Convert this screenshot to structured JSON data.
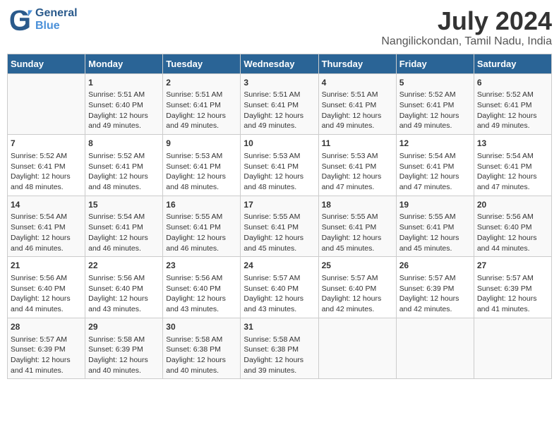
{
  "header": {
    "logo_line1": "General",
    "logo_line2": "Blue",
    "title": "July 2024",
    "subtitle": "Nangilickondan, Tamil Nadu, India"
  },
  "days_of_week": [
    "Sunday",
    "Monday",
    "Tuesday",
    "Wednesday",
    "Thursday",
    "Friday",
    "Saturday"
  ],
  "weeks": [
    [
      {
        "day": "",
        "content": ""
      },
      {
        "day": "1",
        "content": "Sunrise: 5:51 AM\nSunset: 6:40 PM\nDaylight: 12 hours\nand 49 minutes."
      },
      {
        "day": "2",
        "content": "Sunrise: 5:51 AM\nSunset: 6:41 PM\nDaylight: 12 hours\nand 49 minutes."
      },
      {
        "day": "3",
        "content": "Sunrise: 5:51 AM\nSunset: 6:41 PM\nDaylight: 12 hours\nand 49 minutes."
      },
      {
        "day": "4",
        "content": "Sunrise: 5:51 AM\nSunset: 6:41 PM\nDaylight: 12 hours\nand 49 minutes."
      },
      {
        "day": "5",
        "content": "Sunrise: 5:52 AM\nSunset: 6:41 PM\nDaylight: 12 hours\nand 49 minutes."
      },
      {
        "day": "6",
        "content": "Sunrise: 5:52 AM\nSunset: 6:41 PM\nDaylight: 12 hours\nand 49 minutes."
      }
    ],
    [
      {
        "day": "7",
        "content": "Sunrise: 5:52 AM\nSunset: 6:41 PM\nDaylight: 12 hours\nand 48 minutes."
      },
      {
        "day": "8",
        "content": "Sunrise: 5:52 AM\nSunset: 6:41 PM\nDaylight: 12 hours\nand 48 minutes."
      },
      {
        "day": "9",
        "content": "Sunrise: 5:53 AM\nSunset: 6:41 PM\nDaylight: 12 hours\nand 48 minutes."
      },
      {
        "day": "10",
        "content": "Sunrise: 5:53 AM\nSunset: 6:41 PM\nDaylight: 12 hours\nand 48 minutes."
      },
      {
        "day": "11",
        "content": "Sunrise: 5:53 AM\nSunset: 6:41 PM\nDaylight: 12 hours\nand 47 minutes."
      },
      {
        "day": "12",
        "content": "Sunrise: 5:54 AM\nSunset: 6:41 PM\nDaylight: 12 hours\nand 47 minutes."
      },
      {
        "day": "13",
        "content": "Sunrise: 5:54 AM\nSunset: 6:41 PM\nDaylight: 12 hours\nand 47 minutes."
      }
    ],
    [
      {
        "day": "14",
        "content": "Sunrise: 5:54 AM\nSunset: 6:41 PM\nDaylight: 12 hours\nand 46 minutes."
      },
      {
        "day": "15",
        "content": "Sunrise: 5:54 AM\nSunset: 6:41 PM\nDaylight: 12 hours\nand 46 minutes."
      },
      {
        "day": "16",
        "content": "Sunrise: 5:55 AM\nSunset: 6:41 PM\nDaylight: 12 hours\nand 46 minutes."
      },
      {
        "day": "17",
        "content": "Sunrise: 5:55 AM\nSunset: 6:41 PM\nDaylight: 12 hours\nand 45 minutes."
      },
      {
        "day": "18",
        "content": "Sunrise: 5:55 AM\nSunset: 6:41 PM\nDaylight: 12 hours\nand 45 minutes."
      },
      {
        "day": "19",
        "content": "Sunrise: 5:55 AM\nSunset: 6:41 PM\nDaylight: 12 hours\nand 45 minutes."
      },
      {
        "day": "20",
        "content": "Sunrise: 5:56 AM\nSunset: 6:40 PM\nDaylight: 12 hours\nand 44 minutes."
      }
    ],
    [
      {
        "day": "21",
        "content": "Sunrise: 5:56 AM\nSunset: 6:40 PM\nDaylight: 12 hours\nand 44 minutes."
      },
      {
        "day": "22",
        "content": "Sunrise: 5:56 AM\nSunset: 6:40 PM\nDaylight: 12 hours\nand 43 minutes."
      },
      {
        "day": "23",
        "content": "Sunrise: 5:56 AM\nSunset: 6:40 PM\nDaylight: 12 hours\nand 43 minutes."
      },
      {
        "day": "24",
        "content": "Sunrise: 5:57 AM\nSunset: 6:40 PM\nDaylight: 12 hours\nand 43 minutes."
      },
      {
        "day": "25",
        "content": "Sunrise: 5:57 AM\nSunset: 6:40 PM\nDaylight: 12 hours\nand 42 minutes."
      },
      {
        "day": "26",
        "content": "Sunrise: 5:57 AM\nSunset: 6:39 PM\nDaylight: 12 hours\nand 42 minutes."
      },
      {
        "day": "27",
        "content": "Sunrise: 5:57 AM\nSunset: 6:39 PM\nDaylight: 12 hours\nand 41 minutes."
      }
    ],
    [
      {
        "day": "28",
        "content": "Sunrise: 5:57 AM\nSunset: 6:39 PM\nDaylight: 12 hours\nand 41 minutes."
      },
      {
        "day": "29",
        "content": "Sunrise: 5:58 AM\nSunset: 6:39 PM\nDaylight: 12 hours\nand 40 minutes."
      },
      {
        "day": "30",
        "content": "Sunrise: 5:58 AM\nSunset: 6:38 PM\nDaylight: 12 hours\nand 40 minutes."
      },
      {
        "day": "31",
        "content": "Sunrise: 5:58 AM\nSunset: 6:38 PM\nDaylight: 12 hours\nand 39 minutes."
      },
      {
        "day": "",
        "content": ""
      },
      {
        "day": "",
        "content": ""
      },
      {
        "day": "",
        "content": ""
      }
    ]
  ]
}
